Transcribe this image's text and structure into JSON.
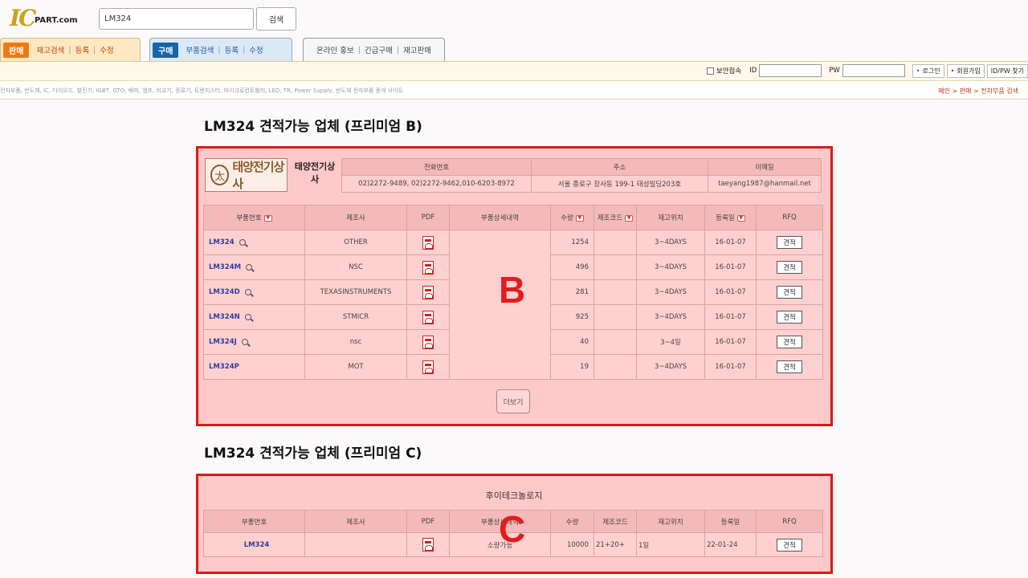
{
  "header": {
    "logo_ic": "IC",
    "logo_part": "PART.com",
    "search_value": "LM324",
    "search_button": "검색"
  },
  "tabs": {
    "sell": {
      "label": "판매",
      "links": [
        "재고검색",
        "등록",
        "수정"
      ]
    },
    "buy": {
      "label": "구매",
      "links": [
        "부품검색",
        "등록",
        "수정"
      ]
    },
    "promo": {
      "links": [
        "온라인 홍보",
        "긴급구매",
        "재고판매"
      ]
    }
  },
  "login": {
    "secure_label": "보안접속",
    "id_label": "ID",
    "pw_label": "PW",
    "login_button": "로그인",
    "join_button": "회원가입",
    "find_button": "ID/PW 찾기"
  },
  "subbar": {
    "description": "전자부품, 반도체, IC, 다이오드, 발진기, IGBT, GTO, 배피, 엠프, 비교기, 증류기, 트랜지스터, 마이크로컨트롤러, LED, TR, Power Supply, 반도체 전자부품 중개 사이트",
    "breadcrumb": "메인 > 판매 > 전자부품 검색"
  },
  "sectionB": {
    "title": "LM324 견적가능 업체 (프리미엄 B)",
    "label": "B",
    "company": {
      "logo_text": "태양전기상사",
      "name": "태양전기상사",
      "headers": [
        "전화번호",
        "주소",
        "이메일"
      ],
      "phone": "02)2272-9489, 02)2272-9462,010-6203-8972",
      "address": "서울 종로구 장사동 199-1 태성빌딩203호",
      "email": "taeyang1987@hanmail.net"
    },
    "columns": [
      "부품번호",
      "제조사",
      "PDF",
      "부품상세내역",
      "수량",
      "제조코드",
      "재고위치",
      "등록일",
      "RFQ"
    ],
    "rows": [
      {
        "part": "LM324",
        "maker": "OTHER",
        "qty": "1254",
        "location": "3~4DAYS",
        "date": "16-01-07",
        "rfq": "견적"
      },
      {
        "part": "LM324M",
        "maker": "NSC",
        "qty": "496",
        "location": "3~4DAYS",
        "date": "16-01-07",
        "rfq": "견적"
      },
      {
        "part": "LM324D",
        "maker": "TEXASINSTRUMENTS",
        "qty": "281",
        "location": "3~4DAYS",
        "date": "16-01-07",
        "rfq": "견적"
      },
      {
        "part": "LM324N",
        "maker": "STMICR",
        "qty": "925",
        "location": "3~4DAYS",
        "date": "16-01-07",
        "rfq": "견적"
      },
      {
        "part": "LM324J",
        "maker": "nsc",
        "qty": "40",
        "location": "3~4일",
        "date": "16-01-07",
        "rfq": "견적"
      },
      {
        "part": "LM324P",
        "maker": "MOT",
        "qty": "19",
        "location": "3~4DAYS",
        "date": "16-01-07",
        "rfq": "견적"
      }
    ],
    "more_button": "더보기"
  },
  "sectionC": {
    "title": "LM324 견적가능 업체 (프리미엄 C)",
    "label": "C",
    "company_name": "후이테크놀로지",
    "columns": [
      "부품번호",
      "제조사",
      "PDF",
      "부품상세내역",
      "수량",
      "제조코드",
      "재고위치",
      "등록일",
      "RFQ"
    ],
    "rows": [
      {
        "part": "LM324",
        "maker": "",
        "detail": "소량가능",
        "qty": "10000",
        "code": "21+20+",
        "location": "1일",
        "date": "22-01-24",
        "rfq": "견적"
      }
    ]
  },
  "colors": {
    "highlight_border": "#d91a1a",
    "highlight_fill": "#ffc9c9",
    "sell_accent": "#ee7a12",
    "buy_accent": "#1565a8"
  }
}
